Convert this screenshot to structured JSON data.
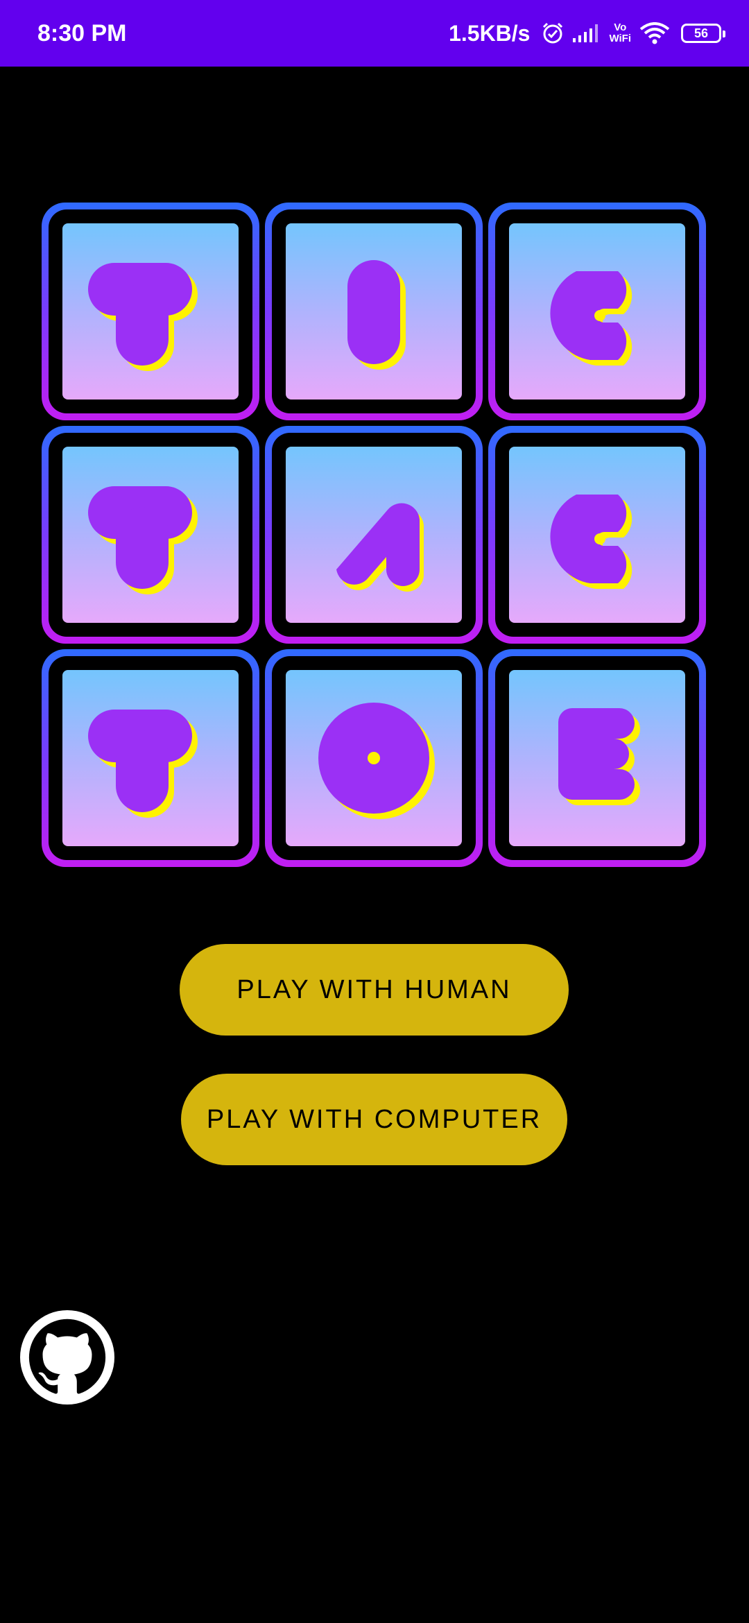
{
  "status_bar": {
    "time": "8:30 PM",
    "net_speed": "1.5KB/s",
    "vowifi_top": "Vo",
    "vowifi_bottom": "WiFi",
    "battery": "56",
    "icons": [
      "alarm-icon",
      "signal-icon",
      "vowifi-icon",
      "wifi-icon",
      "battery-icon"
    ]
  },
  "board": {
    "tiles": [
      "T",
      "I",
      "C",
      "T",
      "A",
      "C",
      "T",
      "O",
      "E"
    ]
  },
  "buttons": {
    "play_human": "PLAY WITH HUMAN",
    "play_computer": "PLAY WITH COMPUTER"
  },
  "footer": {
    "icon": "github-icon"
  },
  "colors": {
    "status_bar": "#6200EE",
    "background": "#000000",
    "button": "#D5B50D",
    "letter": "#9B30F5",
    "letter_shadow": "#FFF200"
  }
}
